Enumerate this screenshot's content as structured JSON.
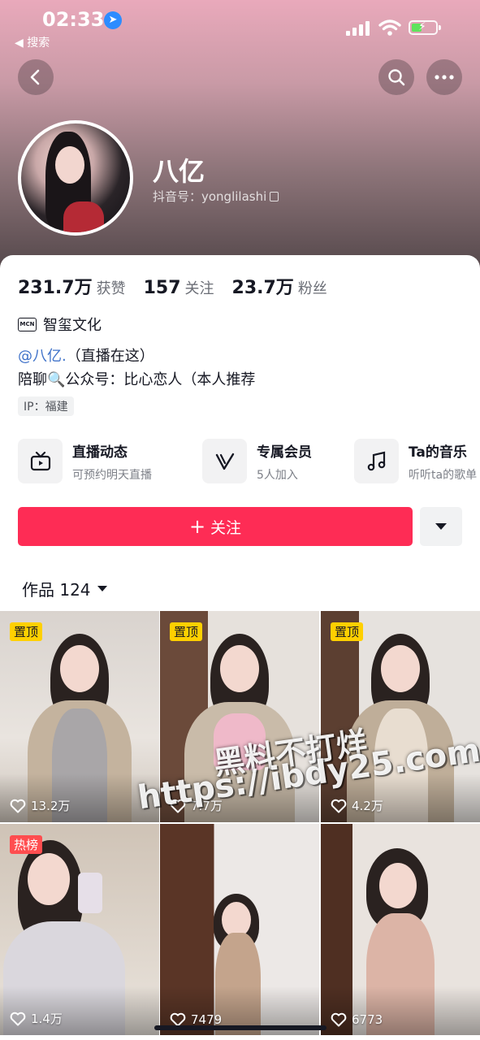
{
  "status_bar": {
    "time": "02:33",
    "back_app": "◀ 搜索"
  },
  "profile": {
    "name": "八亿",
    "douyin_id_label": "抖音号：yonglilashi",
    "stats": [
      {
        "num": "231.7万",
        "label": "获赞"
      },
      {
        "num": "157",
        "label": "关注"
      },
      {
        "num": "23.7万",
        "label": "粉丝"
      }
    ],
    "mcn_badge": "MCN",
    "mcn": "智玺文化",
    "bio_mention": "@八亿.",
    "bio_line1_rest": "（直播在这）",
    "bio_line2": "陪聊🔍公众号：比心恋人（本人推荐",
    "ip": "IP：福建"
  },
  "features": [
    {
      "title": "直播动态",
      "sub": "可预约明天直播",
      "icon": "tv-icon"
    },
    {
      "title": "专属会员",
      "sub": "5人加入",
      "icon": "vip-v-icon"
    },
    {
      "title": "Ta的音乐",
      "sub": "听听ta的歌单",
      "icon": "music-note-icon"
    }
  ],
  "actions": {
    "follow_label": "关注",
    "follow_plus": "+"
  },
  "works": {
    "label": "作品 124"
  },
  "videos": [
    {
      "badge": "置顶",
      "badge_type": "top",
      "likes": "13.2万"
    },
    {
      "badge": "置顶",
      "badge_type": "top",
      "likes": "7.7万"
    },
    {
      "badge": "置顶",
      "badge_type": "top",
      "likes": "4.2万"
    },
    {
      "badge": "热榜",
      "badge_type": "hot",
      "likes": "1.4万"
    },
    {
      "badge": "",
      "badge_type": "",
      "likes": "7479"
    },
    {
      "badge": "",
      "badge_type": "",
      "likes": "6773"
    }
  ],
  "watermark": {
    "line1": "黑料不打烊",
    "line2": "https://ibdy25.com"
  },
  "colors": {
    "follow": "#fe2c55",
    "mention": "#3f72c9",
    "top_badge": "#ffd000",
    "hot_badge": "#ff4d4f"
  }
}
